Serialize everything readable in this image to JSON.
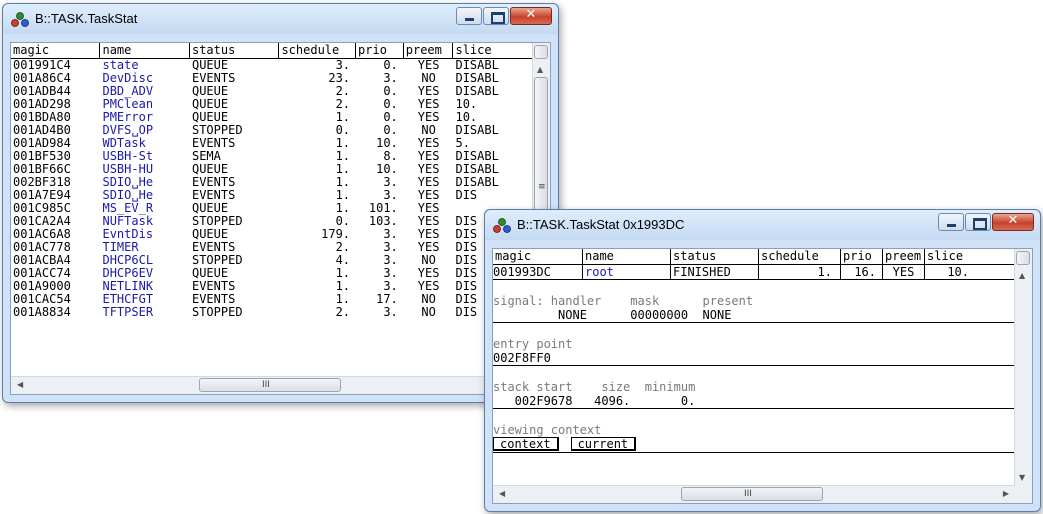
{
  "window1": {
    "title": "B::TASK.TaskStat",
    "columns": [
      "magic",
      "name",
      "status",
      "schedule",
      "prio",
      "preem",
      "slice"
    ],
    "rows": [
      {
        "magic": "001991C4",
        "name": "state",
        "status": "QUEUE",
        "schedule": "3.",
        "prio": "0.",
        "preem": "YES",
        "slice": "DISABL"
      },
      {
        "magic": "001A86C4",
        "name": "DevDisc",
        "status": "EVENTS",
        "schedule": "23.",
        "prio": "3.",
        "preem": "NO",
        "slice": "DISABL"
      },
      {
        "magic": "001ADB44",
        "name": "DBD_ADV",
        "status": "QUEUE",
        "schedule": "2.",
        "prio": "0.",
        "preem": "YES",
        "slice": "DISABL"
      },
      {
        "magic": "001AD298",
        "name": "PMClean",
        "status": "QUEUE",
        "schedule": "2.",
        "prio": "0.",
        "preem": "YES",
        "slice": "10."
      },
      {
        "magic": "001BDA80",
        "name": "PMError",
        "status": "QUEUE",
        "schedule": "1.",
        "prio": "0.",
        "preem": "YES",
        "slice": "10."
      },
      {
        "magic": "001AD4B0",
        "name": "DVFS␣OP",
        "status": "STOPPED",
        "schedule": "0.",
        "prio": "0.",
        "preem": "NO",
        "slice": "DISABL"
      },
      {
        "magic": "001AD984",
        "name": "WDTask",
        "status": "EVENTS",
        "schedule": "1.",
        "prio": "10.",
        "preem": "YES",
        "slice": "5."
      },
      {
        "magic": "001BF530",
        "name": "USBH-St",
        "status": "SEMA",
        "schedule": "1.",
        "prio": "8.",
        "preem": "YES",
        "slice": "DISABL"
      },
      {
        "magic": "001BF66C",
        "name": "USBH-HU",
        "status": "QUEUE",
        "schedule": "1.",
        "prio": "10.",
        "preem": "YES",
        "slice": "DISABL"
      },
      {
        "magic": "002BF318",
        "name": "SDIO␣He",
        "status": "EVENTS",
        "schedule": "1.",
        "prio": "3.",
        "preem": "YES",
        "slice": "DISABL"
      },
      {
        "magic": "001A7E94",
        "name": "SDIO␣He",
        "status": "EVENTS",
        "schedule": "1.",
        "prio": "3.",
        "preem": "YES",
        "slice": "DIS"
      },
      {
        "magic": "001C985C",
        "name": "MS_EV_R",
        "status": "QUEUE",
        "schedule": "1.",
        "prio": "101.",
        "preem": "YES",
        "slice": ""
      },
      {
        "magic": "001CA2A4",
        "name": "NUFTask",
        "status": "STOPPED",
        "schedule": "0.",
        "prio": "103.",
        "preem": "YES",
        "slice": "DIS"
      },
      {
        "magic": "001AC6A8",
        "name": "EvntDis",
        "status": "QUEUE",
        "schedule": "179.",
        "prio": "3.",
        "preem": "YES",
        "slice": "DIS"
      },
      {
        "magic": "001AC778",
        "name": "TIMER",
        "status": "EVENTS",
        "schedule": "2.",
        "prio": "3.",
        "preem": "YES",
        "slice": "DIS"
      },
      {
        "magic": "001ACBA4",
        "name": "DHCP6CL",
        "status": "STOPPED",
        "schedule": "4.",
        "prio": "3.",
        "preem": "NO",
        "slice": "DIS"
      },
      {
        "magic": "001ACC74",
        "name": "DHCP6EV",
        "status": "QUEUE",
        "schedule": "1.",
        "prio": "3.",
        "preem": "YES",
        "slice": "DIS"
      },
      {
        "magic": "001A9000",
        "name": "NETLINK",
        "status": "EVENTS",
        "schedule": "1.",
        "prio": "3.",
        "preem": "YES",
        "slice": "DIS"
      },
      {
        "magic": "001CAC54",
        "name": "ETHCFGT",
        "status": "EVENTS",
        "schedule": "1.",
        "prio": "17.",
        "preem": "NO",
        "slice": "DIS"
      },
      {
        "magic": "001A8834",
        "name": "TFTPSER",
        "status": "STOPPED",
        "schedule": "2.",
        "prio": "3.",
        "preem": "NO",
        "slice": "DIS"
      }
    ]
  },
  "window2": {
    "title": "B::TASK.TaskStat 0x1993DC",
    "columns": [
      "magic",
      "name",
      "status",
      "schedule",
      "prio",
      "preem",
      "slice"
    ],
    "row": {
      "magic": "001993DC",
      "name": "root",
      "status": "FINISHED",
      "schedule": "1.",
      "prio": "16.",
      "preem": "YES",
      "slice": "10."
    },
    "signal": {
      "label": "signal: handler    mask      present",
      "values": "         NONE      00000000  NONE"
    },
    "entry": {
      "label": "entry point",
      "value": "002F8FF0"
    },
    "stack": {
      "label": "stack start    size  minimum",
      "values": "   002F9678   4096.       0."
    },
    "viewing": {
      "label": "viewing context",
      "context_button": "context",
      "current_button": "current"
    }
  },
  "scroll_grip": "III",
  "colors": {
    "title_bg": "#cfe2f7",
    "name_text": "#1a1aa8",
    "close_button": "#c7422b"
  }
}
